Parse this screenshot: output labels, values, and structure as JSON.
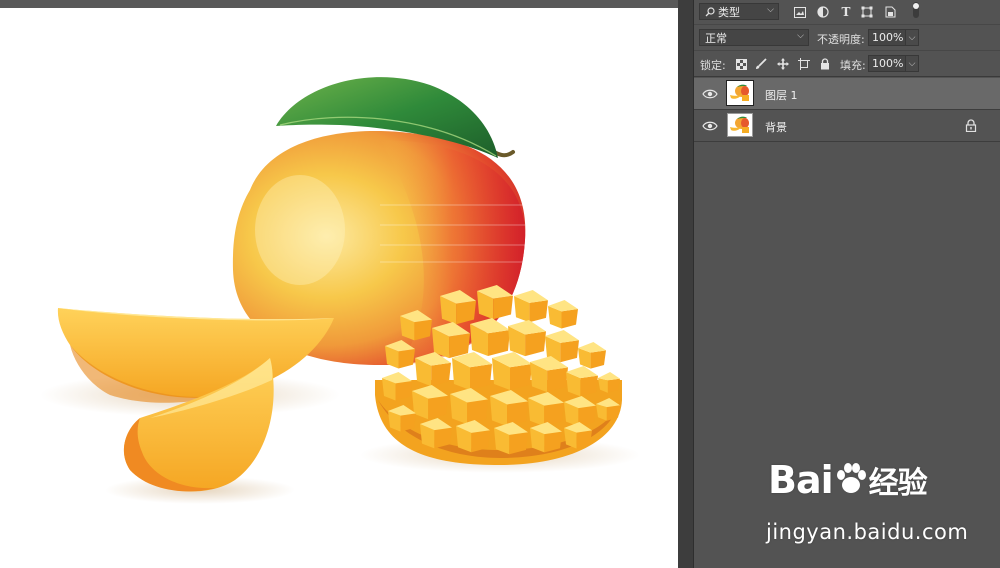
{
  "layers_panel": {
    "filter": {
      "kind_label": "类型",
      "icons": [
        "image-filter-icon",
        "adjustment-filter-icon",
        "type-filter-icon",
        "shape-filter-icon",
        "smart-object-filter-icon",
        "filter-toggle-icon"
      ]
    },
    "blend_mode": "正常",
    "opacity_label": "不透明度:",
    "opacity_value": "100%",
    "lock_label": "锁定:",
    "fill_label": "填充:",
    "fill_value": "100%",
    "layers": [
      {
        "name": "图层 1",
        "selected": true,
        "visible": true,
        "locked": false
      },
      {
        "name": "背景",
        "selected": false,
        "visible": true,
        "locked": true
      }
    ]
  },
  "watermark": {
    "logo_text": "Bai",
    "logo_suffix": "经验",
    "url": "jingyan.baidu.com"
  },
  "colors": {
    "panel_bg": "#535353",
    "selected_layer_bg": "#696969",
    "canvas_bg": "#ffffff"
  }
}
